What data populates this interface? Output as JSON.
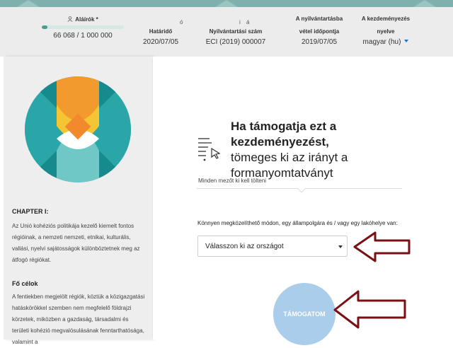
{
  "header": {
    "signatories": {
      "label": "Aláírók *",
      "count": "66 068 / 1 000 000",
      "progress_fraction": 0.066
    },
    "deadline": {
      "label": "Határidő",
      "value": "2020/07/05",
      "stray_mark": "ó"
    },
    "registration_number": {
      "label": "Nyilvántartási szám",
      "value": "ECI (2019) 000007",
      "stray_marks": "i á"
    },
    "registration_date": {
      "label_line1": "A nyilvántartásba",
      "label_line2": "vétel időpontja",
      "value": "2019/07/05"
    },
    "initiative_language": {
      "label_line1": "A kezdeményezés",
      "label_line2": "nyelve",
      "value": "magyar (hu)"
    }
  },
  "sidebar": {
    "chapter_title": "CHAPTER I:",
    "chapter_text": "Az Unió kohéziós politikája kezelő kiemelt fontos régióinak, a nemzeti nemzeti, etnikai, kulturális, vallási, nyelvi sajátosságok különböztetnek meg az átfogó régiókat.",
    "goals_title": "Fő célok",
    "goals_text": "A fentiekben megjelölt régiók, köztük a közigazgatási hatáskörökkel szemben nem megfelelő földrajzi körzetek, miközben a gazdaság, társadalmi és területi kohézió megvalósulásának fenntarthatósága, valamint a"
  },
  "main": {
    "title_bold": "Ha támogatja ezt a kezdeményezést,",
    "title_rest": "tömeges ki az irányt a formanyomtatványt",
    "required_note": "Minden mezőt ki kell tölteni",
    "country_label": "Könnyen megközelíthető módon, egy állampolgára és / vagy egy lakóhelye van:",
    "country_select_value": "Válasszon ki az országot",
    "support_button": "TÁMOGATOM"
  },
  "colors": {
    "teal": "#2aa6a8",
    "dark_teal": "#168a8c",
    "orange": "#f08a2c",
    "yellow": "#f6c533",
    "arrow_red": "#7a0f14",
    "button_blue": "#a9cdea"
  },
  "icons": {
    "signatories": "user-icon",
    "form": "form-cursor-icon",
    "country_caret": "chevron-down-icon",
    "language_caret": "chevron-down-icon"
  }
}
